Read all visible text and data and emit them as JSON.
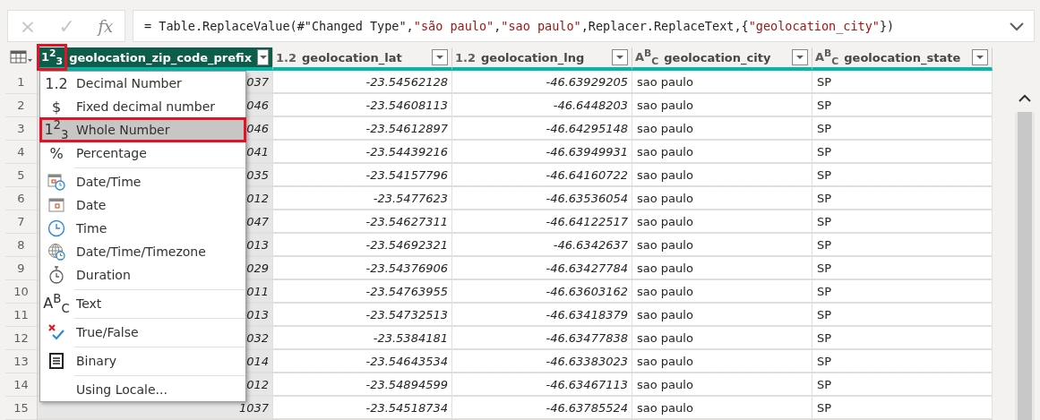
{
  "formula_bar": {
    "cancel": "×",
    "commit": "✓",
    "fx": "fx",
    "formula": "= Table.ReplaceValue(#\"Changed Type\",\"são paulo\",\"sao paulo\",Replacer.ReplaceText,{\"geolocation_city\"})"
  },
  "table": {
    "columns": [
      {
        "type_icon": "1$^{2}$$_{3}$",
        "name": "geolocation_zip_code_prefix",
        "selected": true,
        "kind": "number"
      },
      {
        "type_icon": "1.2",
        "name": "geolocation_lat",
        "selected": false,
        "kind": "number"
      },
      {
        "type_icon": "1.2",
        "name": "geolocation_lng",
        "selected": false,
        "kind": "number"
      },
      {
        "type_icon": "A$^{B}$$_{C}$",
        "name": "geolocation_city",
        "selected": false,
        "kind": "text"
      },
      {
        "type_icon": "A$^{B}$$_{C}$",
        "name": "geolocation_state",
        "selected": false,
        "kind": "text"
      }
    ],
    "rows": [
      {
        "n": "1",
        "cells": [
          "037",
          "-23.54562128",
          "-46.63929205",
          "sao paulo",
          "SP"
        ]
      },
      {
        "n": "2",
        "cells": [
          "046",
          "-23.54608113",
          "-46.6448203",
          "sao paulo",
          "SP"
        ]
      },
      {
        "n": "3",
        "cells": [
          "046",
          "-23.54612897",
          "-46.64295148",
          "sao paulo",
          "SP"
        ]
      },
      {
        "n": "4",
        "cells": [
          "041",
          "-23.54439216",
          "-46.63949931",
          "sao paulo",
          "SP"
        ]
      },
      {
        "n": "5",
        "cells": [
          "035",
          "-23.54157796",
          "-46.64160722",
          "sao paulo",
          "SP"
        ]
      },
      {
        "n": "6",
        "cells": [
          "012",
          "-23.5477623",
          "-46.63536054",
          "sao paulo",
          "SP"
        ]
      },
      {
        "n": "7",
        "cells": [
          "047",
          "-23.54627311",
          "-46.64122517",
          "sao paulo",
          "SP"
        ]
      },
      {
        "n": "8",
        "cells": [
          "013",
          "-23.54692321",
          "-46.6342637",
          "sao paulo",
          "SP"
        ]
      },
      {
        "n": "9",
        "cells": [
          "029",
          "-23.54376906",
          "-46.63427784",
          "sao paulo",
          "SP"
        ]
      },
      {
        "n": "10",
        "cells": [
          "011",
          "-23.54763955",
          "-46.63603162",
          "sao paulo",
          "SP"
        ]
      },
      {
        "n": "11",
        "cells": [
          "013",
          "-23.54732513",
          "-46.63418379",
          "sao paulo",
          "SP"
        ]
      },
      {
        "n": "12",
        "cells": [
          "032",
          "-23.5384181",
          "-46.63477838",
          "sao paulo",
          "SP"
        ]
      },
      {
        "n": "13",
        "cells": [
          "014",
          "-23.54643534",
          "-46.63383023",
          "sao paulo",
          "SP"
        ]
      },
      {
        "n": "14",
        "cells": [
          "012",
          "-23.54894599",
          "-46.63467113",
          "sao paulo",
          "SP"
        ]
      },
      {
        "n": "15",
        "cells": [
          "1037",
          "-23.54518734",
          "-46.63785524",
          "sao paulo",
          "SP"
        ]
      }
    ]
  },
  "type_menu": {
    "items": [
      {
        "kind": "glyph",
        "icon_text": "1.2",
        "label": "Decimal Number",
        "selected": false,
        "separator_before": false
      },
      {
        "kind": "glyph",
        "icon_text": "$",
        "label": "Fixed decimal number",
        "selected": false,
        "separator_before": false
      },
      {
        "kind": "glyph",
        "icon_text": "1$^{2}$$_{3}$",
        "label": "Whole Number",
        "selected": true,
        "separator_before": false
      },
      {
        "kind": "glyph",
        "icon_text": "%",
        "label": "Percentage",
        "selected": false,
        "separator_before": false
      },
      {
        "kind": "datetime",
        "label": "Date/Time",
        "selected": false,
        "separator_before": true
      },
      {
        "kind": "date",
        "label": "Date",
        "selected": false,
        "separator_before": false
      },
      {
        "kind": "time",
        "label": "Time",
        "selected": false,
        "separator_before": false
      },
      {
        "kind": "timezone",
        "label": "Date/Time/Timezone",
        "selected": false,
        "separator_before": false
      },
      {
        "kind": "duration",
        "label": "Duration",
        "selected": false,
        "separator_before": false
      },
      {
        "kind": "glyph",
        "icon_text": "A$^{B}$$_{C}$",
        "label": "Text",
        "selected": false,
        "separator_before": true
      },
      {
        "kind": "truefalse",
        "label": "True/False",
        "selected": false,
        "separator_before": true
      },
      {
        "kind": "binary",
        "label": "Binary",
        "selected": false,
        "separator_before": true
      },
      {
        "kind": "none",
        "label": "Using Locale...",
        "selected": false,
        "separator_before": true
      }
    ]
  }
}
